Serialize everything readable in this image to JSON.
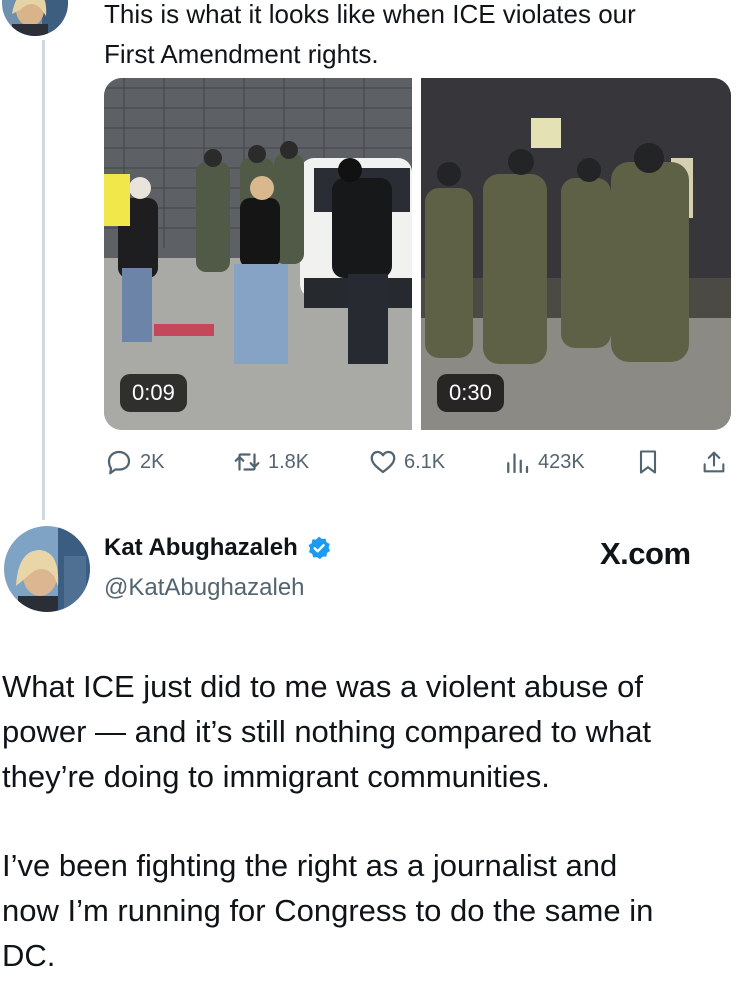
{
  "top_tweet": {
    "text_lines": [
      "This is what it looks like when ICE violates our",
      "First Amendment rights."
    ],
    "videos": [
      {
        "duration": "0:09"
      },
      {
        "duration": "0:30"
      }
    ],
    "actions": {
      "replies": "2K",
      "reposts": "1.8K",
      "likes": "6.1K",
      "views": "423K"
    }
  },
  "second_tweet": {
    "display_name": "Kat Abughazaleh",
    "handle": "@KatAbughazaleh",
    "source_label": "X.com",
    "paragraphs": [
      [
        "What ICE just did to me was a violent abuse of",
        "power — and it’s still nothing compared to what",
        "they’re doing to immigrant communities."
      ],
      [
        "I’ve been fighting the right as a journalist and",
        "now I’m running for Congress to do the same in",
        "DC."
      ]
    ]
  },
  "colors": {
    "text": "#0f1419",
    "secondary": "#536471",
    "verified": "#1d9bf0",
    "thread_line": "#cfd9de"
  }
}
